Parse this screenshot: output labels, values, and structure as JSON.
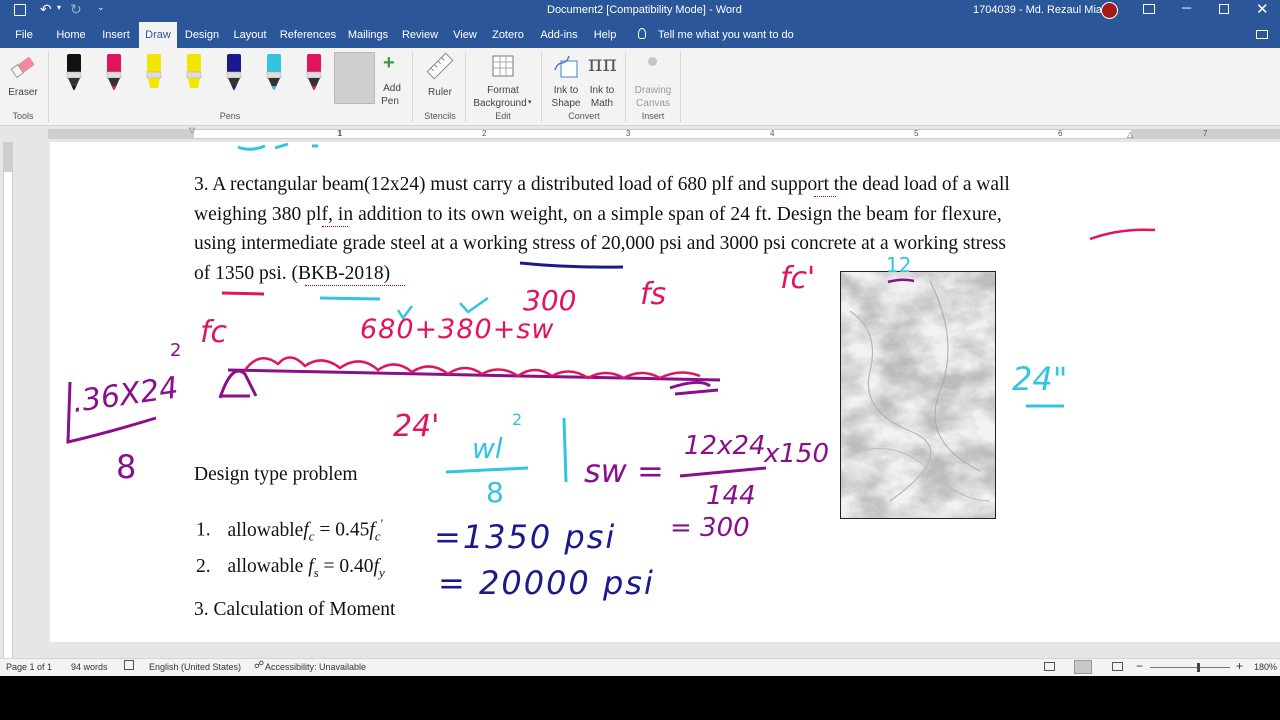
{
  "titlebar": {
    "doc_title": "Document2 [Compatibility Mode] - Word",
    "user": "1704039 - Md. Rezaul Miah"
  },
  "tabs": [
    "File",
    "Home",
    "Insert",
    "Draw",
    "Design",
    "Layout",
    "References",
    "Mailings",
    "Review",
    "View",
    "Zotero",
    "Add-ins",
    "Help"
  ],
  "active_tab": "Draw",
  "tellme": "Tell me what you want to do",
  "ribbon": {
    "eraser": "Eraser",
    "add_pen": [
      "Add",
      "Pen"
    ],
    "ruler": "Ruler",
    "format_bg": [
      "Format",
      "Background"
    ],
    "ink_to_shape": [
      "Ink to",
      "Shape"
    ],
    "ink_to_math": [
      "Ink to",
      "Math"
    ],
    "drawing_canvas": [
      "Drawing",
      "Canvas"
    ],
    "groups": {
      "tools": "Tools",
      "pens": "Pens",
      "stencils": "Stencils",
      "edit": "Edit",
      "convert": "Convert",
      "insert": "Insert"
    },
    "pen_colors": [
      "#111111",
      "#e0155f",
      "#f2e600",
      "#f2e600",
      "#1a1a8c",
      "#33c4e0",
      "#e0155f",
      "#8a0f8a"
    ]
  },
  "ruler_numbers": [
    "1",
    "1",
    "2",
    "3",
    "4",
    "5",
    "6",
    "7"
  ],
  "document": {
    "problem_lines": [
      "3. A rectangular beam(12x24) must carry a distributed load of 680 plf and support the dead load of a wall",
      "weighing 380 plf, in addition to its own weight, on a simple span of 24 ft. Design the beam for flexure,",
      "using intermediate grade steel at a working stress of 20,000 psi and 3000 psi concrete at a working stress",
      "of 1350 psi. (BKB-2018)"
    ],
    "design_type": "Design type problem",
    "list": [
      {
        "num": "1.",
        "text": "allowable",
        "var": "f",
        "sub": "c",
        "eq": " = 0.45",
        "var2": "f",
        "sub2": "c",
        "prime": "′"
      },
      {
        "num": "2.",
        "text": "allowable ",
        "var": "f",
        "sub": "s",
        "eq": " = 0.40",
        "var2": "f",
        "sub2": "y",
        "prime": ""
      },
      {
        "num": "3.",
        "text": "Calculation of Moment"
      }
    ]
  },
  "ink_text": {
    "load_sum": "680+380+sw",
    "three_hundred": "300",
    "fs": "fs",
    "fc_left": "fc",
    "fc_prime": "fc'",
    "twelve": "12",
    "twentyfour_ft": "24'",
    "twentyfour_in": "24\"",
    "moment_num": ".36X24",
    "moment_exp": "2",
    "moment_den": "8",
    "wl_num": "wl",
    "wl_exp": "2",
    "wl_den": "8",
    "sw_lhs": "sw =",
    "sw_num": "12x24",
    "sw_mul": "x150",
    "sw_den": "144",
    "sw_result": "= 300",
    "fc_val": "=1350 psi",
    "fs_val": "= 20000 psi"
  },
  "status": {
    "page": "Page 1 of 1",
    "words": "94 words",
    "language": "English (United States)",
    "accessibility": "Accessibility: Unavailable",
    "zoom": "180%"
  }
}
